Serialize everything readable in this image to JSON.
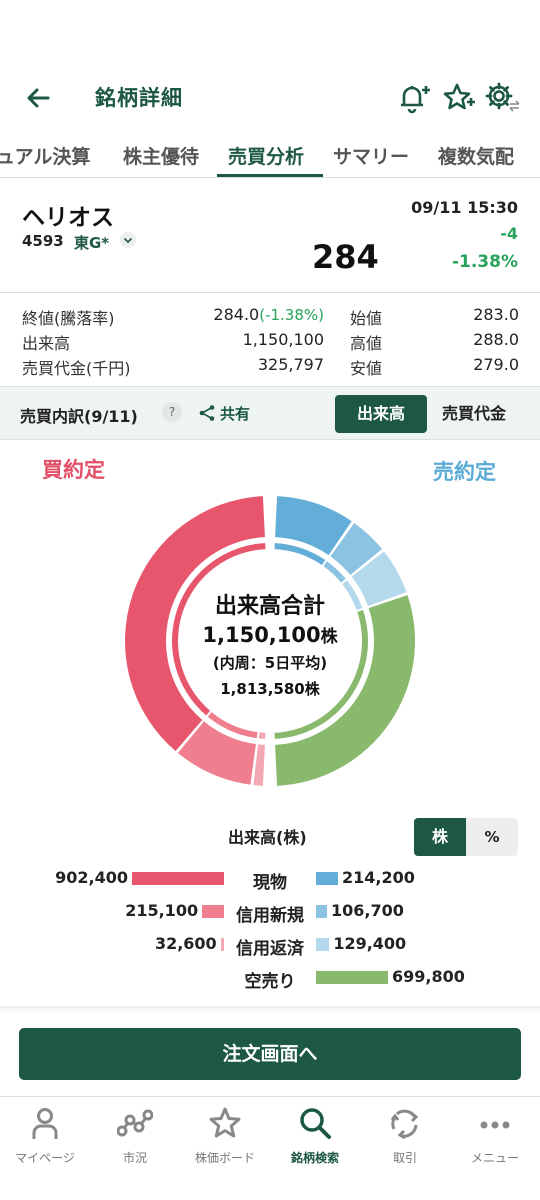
{
  "header": {
    "title": "銘柄詳細"
  },
  "tabs": [
    {
      "label": "ュアル決算"
    },
    {
      "label": "株主優待"
    },
    {
      "label": "売買分析"
    },
    {
      "label": "サマリー"
    },
    {
      "label": "複数気配"
    }
  ],
  "stock": {
    "name": "ヘリオス",
    "code": "4593",
    "market": "東G*",
    "datetime": "09/11 15:30",
    "price": "284",
    "change": "-4",
    "change_pct": "-1.38%"
  },
  "quotes": {
    "close_label": "終値(騰落率)",
    "close_value": "284.0",
    "close_pct": "(-1.38%)",
    "volume_label": "出来高",
    "volume_value": "1,150,100",
    "turnover_label": "売買代金(千円)",
    "turnover_value": "325,797",
    "open_label": "始値",
    "open_value": "283.0",
    "high_label": "高値",
    "high_value": "288.0",
    "low_label": "安値",
    "low_value": "279.0"
  },
  "breakdown": {
    "title": "売買内訳(9/11)",
    "help": "?",
    "share_label": "共有",
    "toggle_volume": "出来高",
    "toggle_value": "売買代金"
  },
  "buy_label": "買約定",
  "sell_label": "売約定",
  "donut_center": {
    "title": "出来高合計",
    "total": "1,150,100",
    "unit": "株",
    "note": "(内周：5日平均)",
    "avg": "1,813,580",
    "avg_unit": "株"
  },
  "volume_table": {
    "title": "出来高(株)",
    "unit_shares": "株",
    "unit_pct": "%"
  },
  "chart_data": {
    "type": "bar",
    "categories": [
      "現物",
      "信用新規",
      "信用返済",
      "空売り"
    ],
    "series": [
      {
        "name": "買約定",
        "values": [
          902400,
          215100,
          32600,
          null
        ]
      },
      {
        "name": "売約定",
        "values": [
          214200,
          106700,
          129400,
          699800
        ]
      }
    ],
    "buy_labels": [
      "902,400",
      "215,100",
      "32,600",
      ""
    ],
    "sell_labels": [
      "214,200",
      "106,700",
      "129,400",
      "699,800"
    ],
    "colors": {
      "buy": [
        "#e8566d",
        "#ef7f8f",
        "#f4a8b2"
      ],
      "sell": [
        "#62aed8",
        "#8cc3e2",
        "#b5d9ec",
        "#88b96c"
      ]
    }
  },
  "order_button": "注文画面へ",
  "nav": [
    {
      "label": "マイページ",
      "icon": "person-icon"
    },
    {
      "label": "市況",
      "icon": "network-icon"
    },
    {
      "label": "株価ボード",
      "icon": "star-icon"
    },
    {
      "label": "銘柄検索",
      "icon": "search-icon"
    },
    {
      "label": "取引",
      "icon": "recycle-icon"
    },
    {
      "label": "メニュー",
      "icon": "more-icon"
    }
  ]
}
